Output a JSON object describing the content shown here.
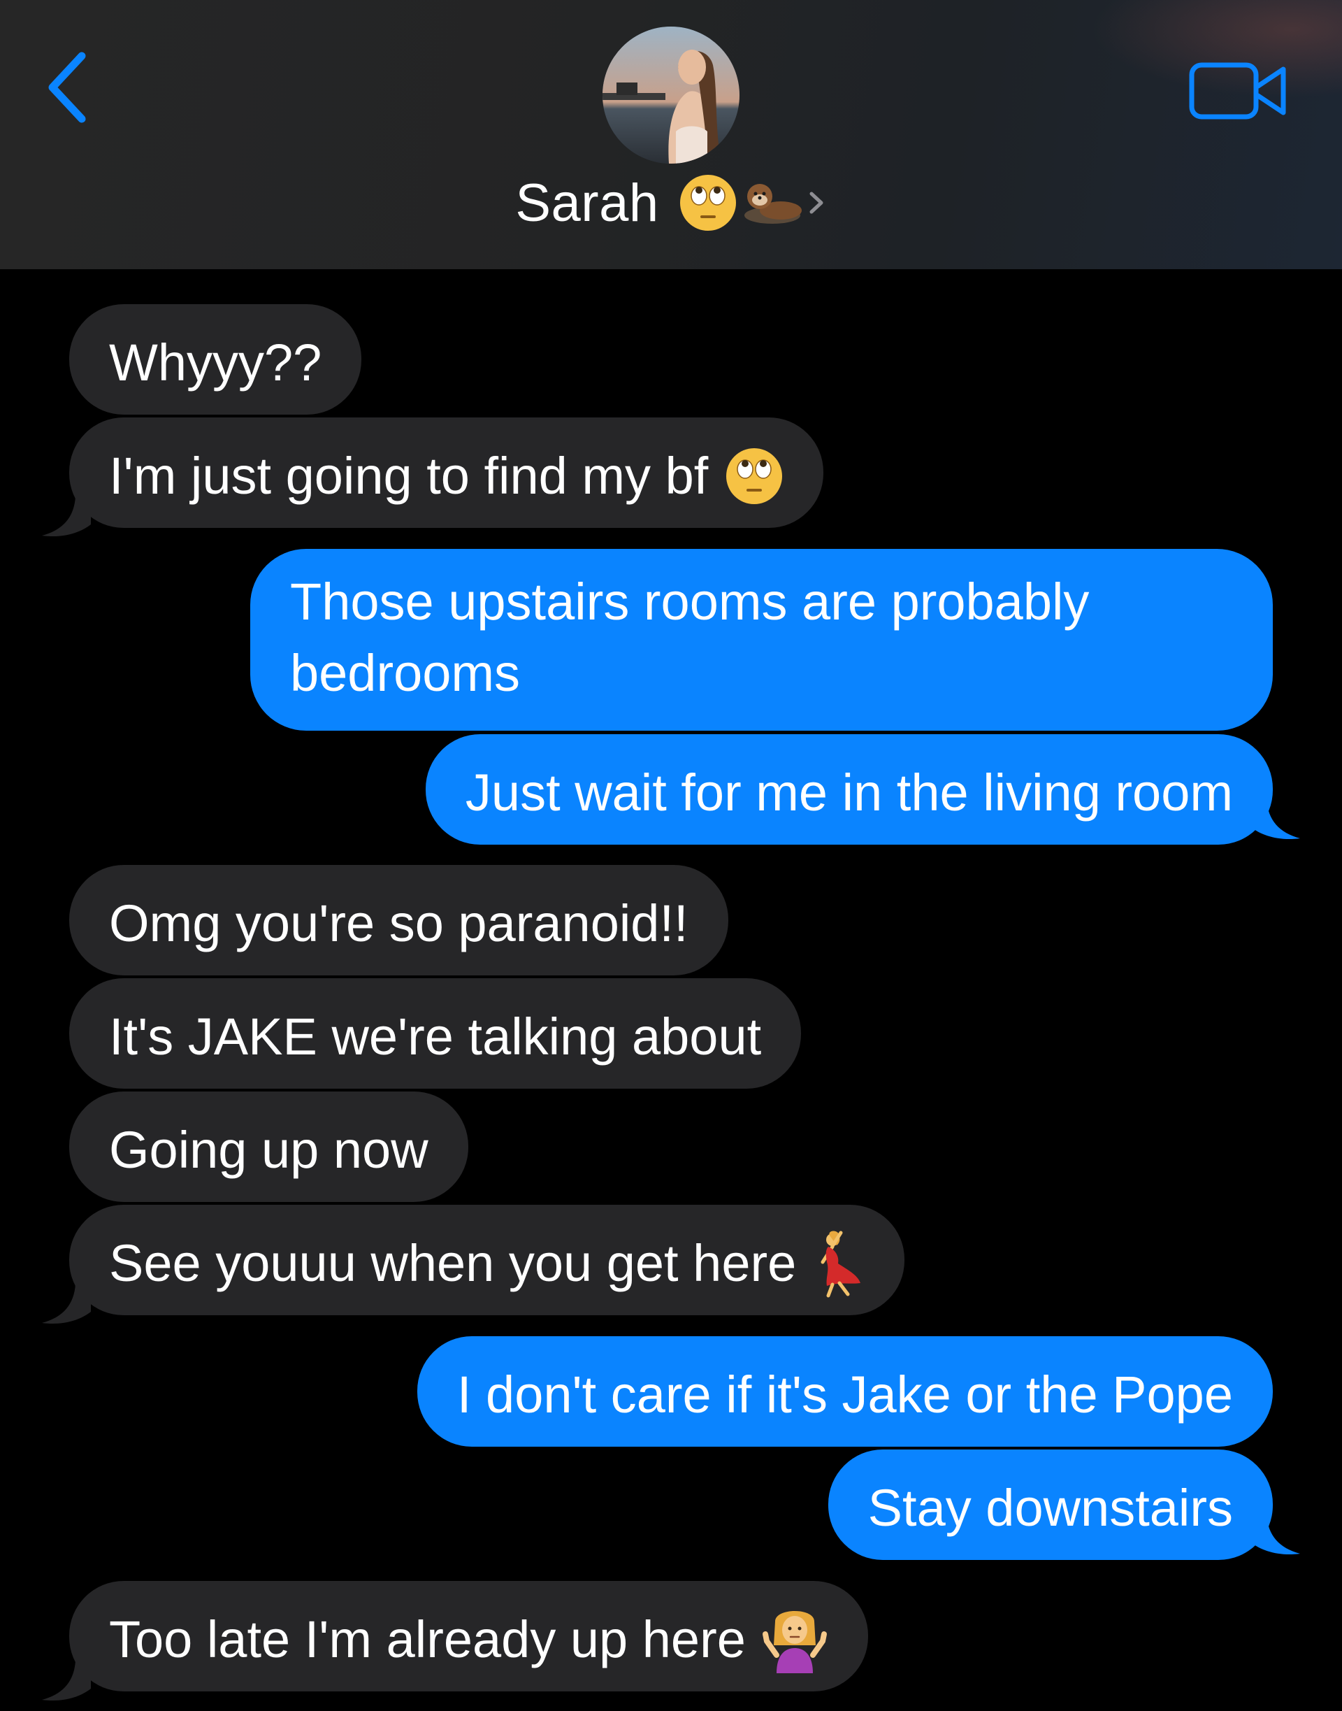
{
  "header": {
    "contact_name": "Sarah",
    "name_emojis": [
      "face-with-rolling-eyes-emoji",
      "otter-emoji"
    ],
    "back_icon": "chevron-left-icon",
    "video_icon": "video-camera-icon",
    "chevron_icon": "chevron-right-icon"
  },
  "messages": [
    {
      "direction": "incoming",
      "text": "Whyyy??"
    },
    {
      "direction": "incoming",
      "text": "I'm just going to find my bf",
      "emoji": "face-with-rolling-eyes-emoji"
    },
    {
      "direction": "outgoing",
      "text": "Those upstairs rooms are probably bedrooms"
    },
    {
      "direction": "outgoing",
      "text": "Just wait for me in the living room"
    },
    {
      "direction": "incoming",
      "text": "Omg you're so paranoid!!"
    },
    {
      "direction": "incoming",
      "text": "It's JAKE we're talking about"
    },
    {
      "direction": "incoming",
      "text": "Going up now"
    },
    {
      "direction": "incoming",
      "text": "See youuu when you get here",
      "emoji": "woman-dancing-emoji"
    },
    {
      "direction": "outgoing",
      "text": "I don't care if it's Jake or the Pope"
    },
    {
      "direction": "outgoing",
      "text": "Stay downstairs"
    },
    {
      "direction": "incoming",
      "text": "Too late I'm already up here",
      "emoji": "person-shrugging-emoji"
    }
  ],
  "colors": {
    "incoming_bubble": "#262628",
    "outgoing_bubble": "#0a84ff",
    "background": "#000000",
    "accent": "#0a84ff"
  }
}
